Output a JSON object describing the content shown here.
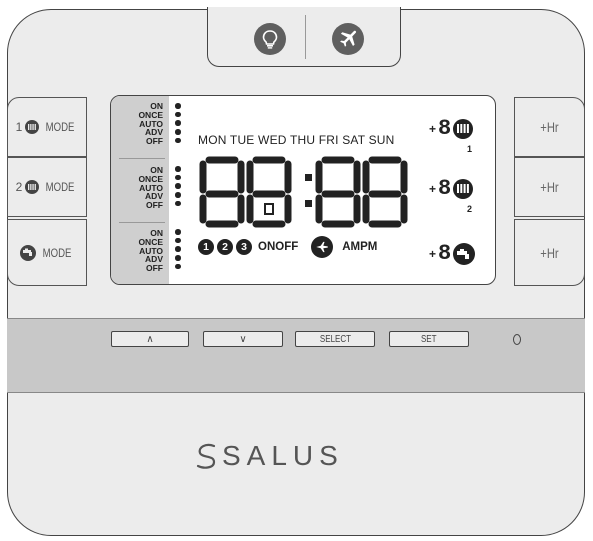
{
  "top_buttons": [
    {
      "icon": "lightbulb-icon"
    },
    {
      "icon": "airplane-icon"
    }
  ],
  "left_buttons": [
    {
      "prefix": "1",
      "icon": "radiator-icon",
      "label": "MODE"
    },
    {
      "prefix": "2",
      "icon": "radiator-icon",
      "label": "MODE"
    },
    {
      "prefix": "",
      "icon": "tap-icon",
      "label": "MODE"
    }
  ],
  "right_buttons": [
    {
      "label": "+Hr"
    },
    {
      "label": "+Hr"
    },
    {
      "label": "+Hr"
    }
  ],
  "lcd": {
    "mode_lists": [
      [
        "ON",
        "ONCE",
        "AUTO",
        "ADV",
        "OFF"
      ],
      [
        "ON",
        "ONCE",
        "AUTO",
        "ADV",
        "OFF"
      ],
      [
        "ON",
        "ONCE",
        "AUTO",
        "ADV",
        "OFF"
      ]
    ],
    "days": "MON TUE WED THU FRI SAT SUN",
    "time": "88:88",
    "zone_numbers": [
      "1",
      "2"
    ],
    "bottom": {
      "numbers": [
        "1",
        "2",
        "3"
      ],
      "onoff": "ONOFF",
      "ampm": "AMPM"
    },
    "zone_prefix": "+",
    "zone_digit": "8"
  },
  "control_buttons": [
    {
      "name": "up",
      "label": "∧"
    },
    {
      "name": "down",
      "label": "∨"
    },
    {
      "name": "select",
      "label": "SELECT"
    },
    {
      "name": "set",
      "label": "SET"
    }
  ],
  "brand": "SALUS",
  "colors": {
    "body": "#ececec",
    "panel": "#c8c8c8",
    "lcd_strip": "#cfcfcf",
    "icon_dark": "#5f5f5f"
  }
}
